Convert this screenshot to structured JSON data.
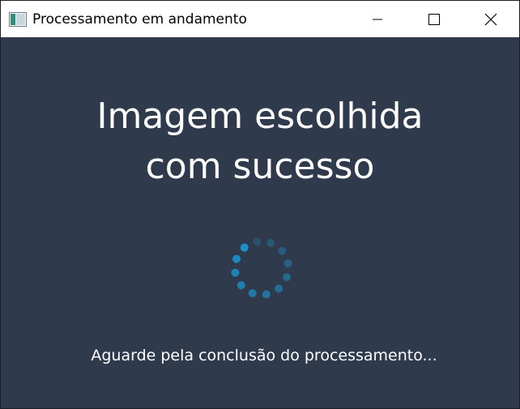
{
  "window": {
    "title": "Processamento em andamento",
    "icon": "app-window-icon",
    "controls": [
      "minimize-icon",
      "maximize-icon",
      "close-icon"
    ]
  },
  "main": {
    "title_line1": "Imagem escolhida",
    "title_line2": "com sucesso",
    "status": "Aguarde pela conclusão do processamento..."
  },
  "spinner": {
    "icon": "loading-spinner-icon",
    "dot_count": 12
  },
  "colors": {
    "background": "#2f3b4d",
    "titlebar": "#ffffff",
    "text": "#ffffff",
    "spinner": "#1e8fc8"
  }
}
